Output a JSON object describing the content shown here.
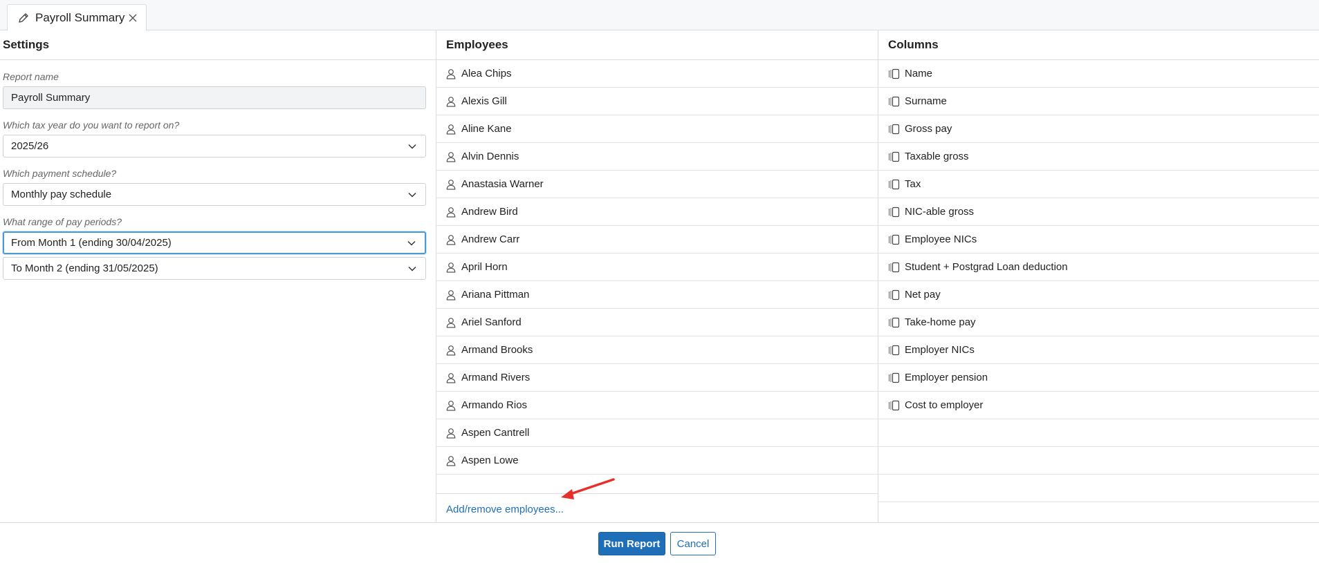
{
  "tab": {
    "label": "Payroll Summary",
    "edit_icon": "pencil-icon",
    "close_icon": "close-icon"
  },
  "settings": {
    "header": "Settings",
    "report_name_label": "Report name",
    "report_name_value": "Payroll Summary",
    "tax_year_label": "Which tax year do you want to report on?",
    "tax_year_value": "2025/26",
    "schedule_label": "Which payment schedule?",
    "schedule_value": "Monthly pay schedule",
    "range_label": "What range of pay periods?",
    "range_from_value": "From Month 1 (ending 30/04/2025)",
    "range_to_value": "To Month 2 (ending 31/05/2025)"
  },
  "employees": {
    "header": "Employees",
    "items": [
      "Alea Chips",
      "Alexis Gill",
      "Aline Kane",
      "Alvin Dennis",
      "Anastasia Warner",
      "Andrew Bird",
      "Andrew Carr",
      "April Horn",
      "Ariana Pittman",
      "Ariel Sanford",
      "Armand Brooks",
      "Armand Rivers",
      "Armando Rios",
      "Aspen Cantrell",
      "Aspen Lowe"
    ],
    "add_remove_link": "Add/remove employees..."
  },
  "columns": {
    "header": "Columns",
    "items": [
      "Name",
      "Surname",
      "Gross pay",
      "Taxable gross",
      "Tax",
      "NIC-able gross",
      "Employee NICs",
      "Student + Postgrad Loan deduction",
      "Net pay",
      "Take-home pay",
      "Employer NICs",
      "Employer pension",
      "Cost to employer"
    ]
  },
  "footer": {
    "run_label": "Run Report",
    "cancel_label": "Cancel"
  },
  "colors": {
    "accent": "#1f6fb8",
    "focus": "#4a9ad6",
    "annotation_arrow": "#e8302a"
  }
}
